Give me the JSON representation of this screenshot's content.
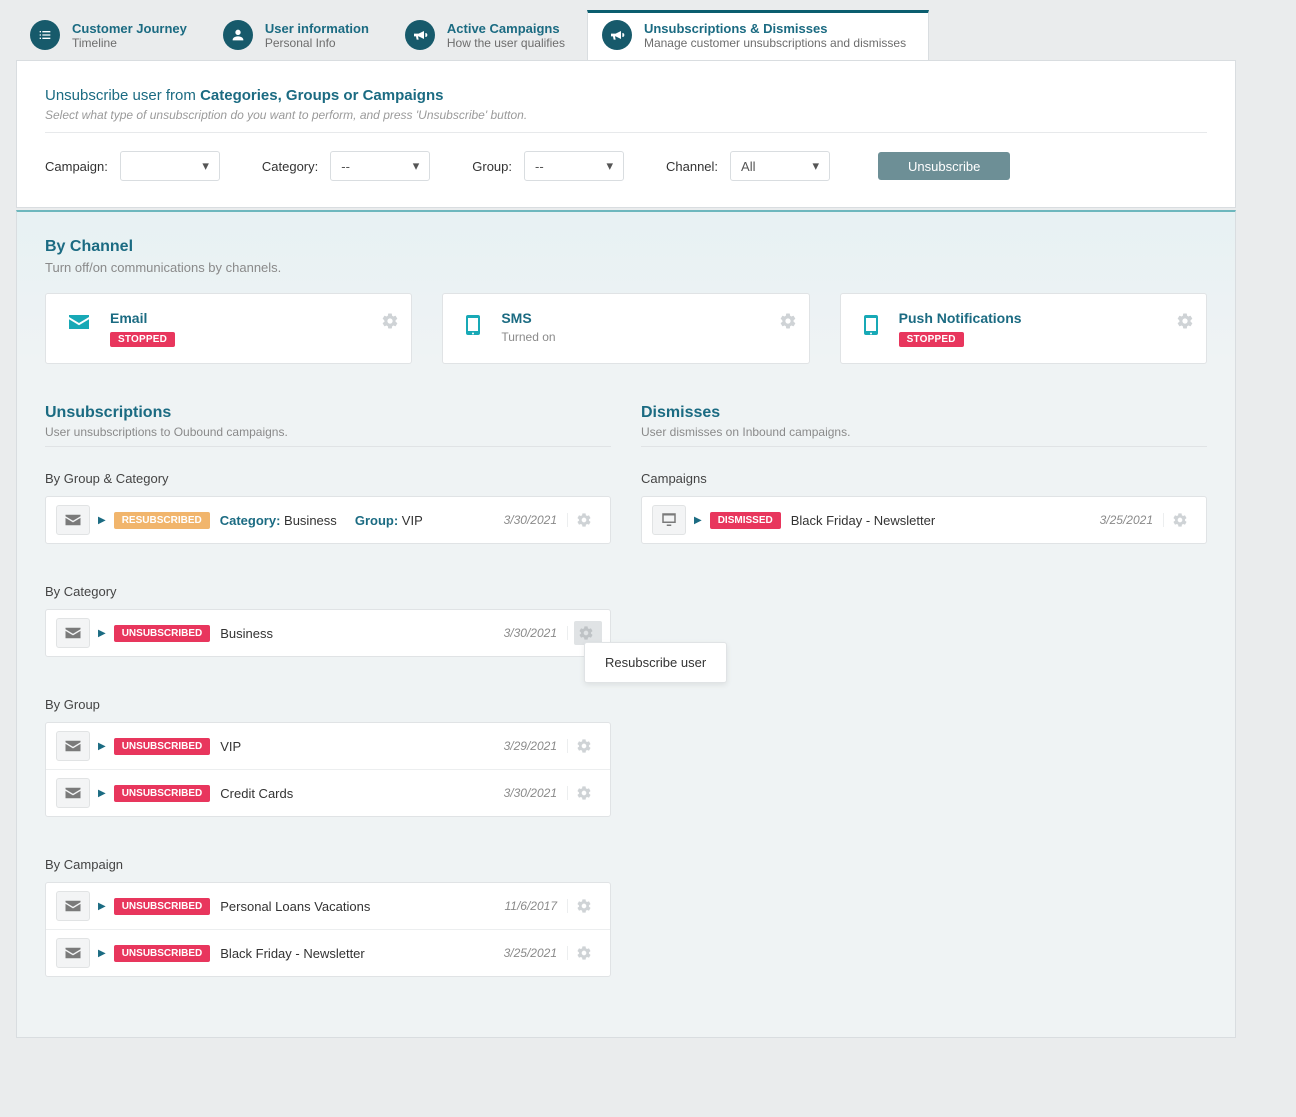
{
  "tabs": [
    {
      "title": "Customer Journey",
      "sub": "Timeline",
      "icon": "list"
    },
    {
      "title": "User information",
      "sub": "Personal Info",
      "icon": "user"
    },
    {
      "title": "Active Campaigns",
      "sub": "How the user qualifies",
      "icon": "megaphone"
    },
    {
      "title": "Unsubscriptions & Dismisses",
      "sub": "Manage customer unsubscriptions and dismisses",
      "icon": "megaphone",
      "active": true
    }
  ],
  "unsubscribe_box": {
    "title_a": "Unsubscribe user from ",
    "title_b": "Categories, Groups or Campaigns",
    "help": "Select what type of unsubscription do you want to perform, and press 'Unsubscribe' button.",
    "labels": {
      "campaign": "Campaign:",
      "category": "Category:",
      "group": "Group:",
      "channel": "Channel:"
    },
    "values": {
      "campaign": "",
      "category": "--",
      "group": "--",
      "channel": "All"
    },
    "button": "Unsubscribe"
  },
  "by_channel": {
    "title": "By Channel",
    "sub": "Turn off/on communications by channels.",
    "stopped": "STOPPED",
    "items": [
      {
        "name": "Email",
        "state": "stopped",
        "line": ""
      },
      {
        "name": "SMS",
        "state": "on",
        "line": "Turned on"
      },
      {
        "name": "Push Notifications",
        "state": "stopped",
        "line": ""
      }
    ]
  },
  "left": {
    "title": "Unsubscriptions",
    "sub": "User unsubscriptions to Oubound campaigns.",
    "sections": {
      "gc": "By Group & Category",
      "cat": "By Category",
      "grp": "By Group",
      "cmp": "By Campaign"
    },
    "gc_row": {
      "pill": "RESUBSCRIBED",
      "cat_label": "Category:",
      "cat": "Business",
      "grp_label": "Group:",
      "grp": "VIP",
      "date": "3/30/2021"
    },
    "cat_row": {
      "pill": "UNSUBSCRIBED",
      "name": "Business",
      "date": "3/30/2021"
    },
    "popover": "Resubscribe user",
    "grp_rows": [
      {
        "pill": "UNSUBSCRIBED",
        "name": "VIP",
        "date": "3/29/2021",
        "icon": "multi"
      },
      {
        "pill": "UNSUBSCRIBED",
        "name": "Credit Cards",
        "date": "3/30/2021",
        "icon": "mail"
      }
    ],
    "cmp_rows": [
      {
        "pill": "UNSUBSCRIBED",
        "name": "Personal Loans Vacations",
        "date": "11/6/2017"
      },
      {
        "pill": "UNSUBSCRIBED",
        "name": "Black Friday - Newsletter",
        "date": "3/25/2021"
      }
    ]
  },
  "right": {
    "title": "Dismisses",
    "sub": "User dismisses on Inbound campaigns.",
    "section": "Campaigns",
    "row": {
      "pill": "DISMISSED",
      "name": "Black Friday - Newsletter",
      "date": "3/25/2021"
    }
  }
}
